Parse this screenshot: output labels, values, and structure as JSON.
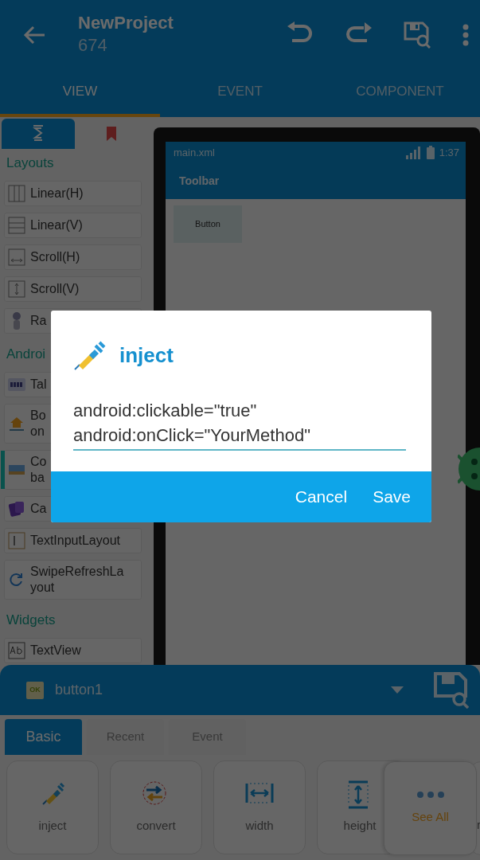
{
  "app_bar": {
    "title": "NewProject",
    "subtitle": "674"
  },
  "tabs": [
    {
      "label": "VIEW",
      "selected": true
    },
    {
      "label": "EVENT",
      "selected": false
    },
    {
      "label": "COMPONENT",
      "selected": false
    }
  ],
  "palette_tabs": [
    {
      "kind": "widgets",
      "selected": true
    },
    {
      "kind": "bookmarks",
      "selected": false
    }
  ],
  "palette": [
    {
      "kind": "header",
      "label": "Layouts"
    },
    {
      "kind": "item",
      "label": "Linear(H)",
      "selected": false
    },
    {
      "kind": "item",
      "label": "Linear(V)",
      "selected": false
    },
    {
      "kind": "item",
      "label": "Scroll(H)",
      "selected": false
    },
    {
      "kind": "item",
      "label": "Scroll(V)",
      "selected": false
    },
    {
      "kind": "item",
      "label": "Ra",
      "selected": false
    },
    {
      "kind": "header",
      "label": "Androi"
    },
    {
      "kind": "item",
      "label": "Tal",
      "selected": false
    },
    {
      "kind": "item",
      "label": "Bo\non",
      "selected": false
    },
    {
      "kind": "item",
      "label": "Co\nba",
      "selected": true
    },
    {
      "kind": "item",
      "label": "Ca",
      "selected": false
    },
    {
      "kind": "item",
      "label": "TextInputLayout",
      "selected": false
    },
    {
      "kind": "item",
      "label": "SwipeRefreshLa\nyout",
      "selected": false
    },
    {
      "kind": "header",
      "label": "Widgets"
    },
    {
      "kind": "item",
      "label": "TextView",
      "selected": false
    }
  ],
  "preview": {
    "file": "main.xml",
    "time": "1:37",
    "toolbar": "Toolbar",
    "widget": "Button"
  },
  "properties": {
    "widget_icon": "OK",
    "widget": "button1",
    "tabs": [
      {
        "label": "Basic",
        "selected": true
      },
      {
        "label": "Recent",
        "selected": false
      },
      {
        "label": "Event",
        "selected": false
      }
    ],
    "actions": [
      {
        "label": "inject"
      },
      {
        "label": "convert"
      },
      {
        "label": "width"
      },
      {
        "label": "height"
      },
      {
        "label": "r"
      }
    ],
    "see_all": "See All"
  },
  "dialog": {
    "title": "inject",
    "value": "android:clickable=\"true\"\nandroid:onClick=\"YourMethod\"",
    "buttons": [
      "Cancel",
      "Save"
    ]
  }
}
